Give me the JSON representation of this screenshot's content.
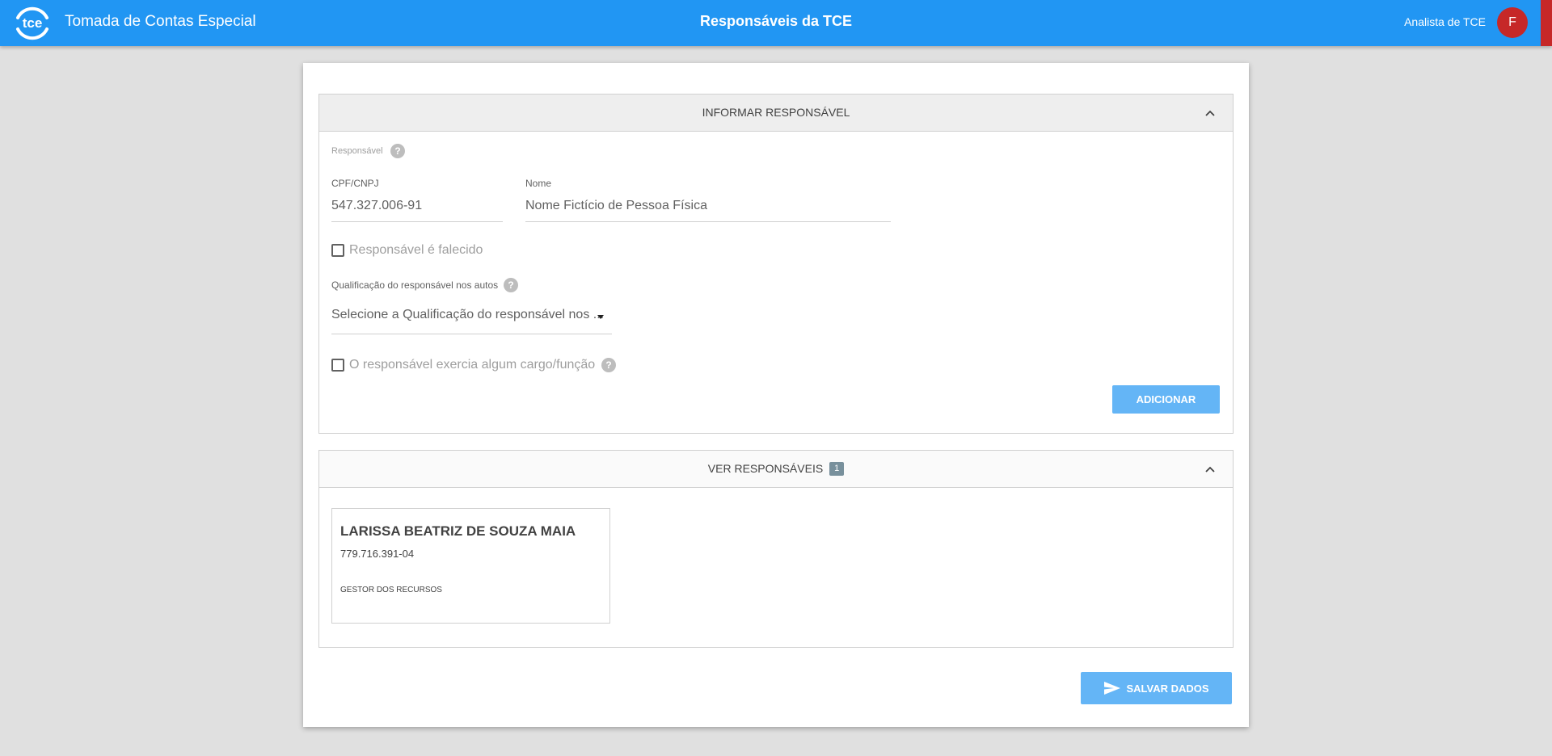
{
  "header": {
    "logo_text": "tce",
    "app_title": "Tomada de Contas Especial",
    "page_title": "Responsáveis da TCE",
    "user_role": "Analista de TCE",
    "avatar_initial": "F"
  },
  "form_panel": {
    "title": "INFORMAR RESPONSÁVEL",
    "section_label": "Responsável",
    "cpf_label": "CPF/CNPJ",
    "cpf_value": "547.327.006-91",
    "nome_label": "Nome",
    "nome_value": "Nome Fictício de Pessoa Física",
    "falecido_label": "Responsável é falecido",
    "falecido_checked": false,
    "qualificacao_label": "Qualificação do responsável nos autos",
    "qualificacao_selected": "Selecione a Qualificação do responsável nos ...",
    "cargo_label": "O responsável exercia algum cargo/função",
    "cargo_checked": false,
    "add_button": "ADICIONAR",
    "help_glyph": "?"
  },
  "list_panel": {
    "title": "VER RESPONSÁVEIS",
    "count": "1",
    "items": [
      {
        "name": "LARISSA BEATRIZ DE SOUZA MAIA",
        "cpf": "779.716.391-04",
        "role": "GESTOR DOS RECURSOS"
      }
    ]
  },
  "footer": {
    "save_button": "SALVAR DADOS"
  },
  "colors": {
    "topbar": "#2196f3",
    "accent_red": "#c62828",
    "button_disabled_blue": "#64b5f6",
    "badge": "#78909c"
  },
  "icons": [
    "logo-icon",
    "help-icon",
    "chevron-up-icon",
    "send-icon",
    "caret-down-icon"
  ]
}
